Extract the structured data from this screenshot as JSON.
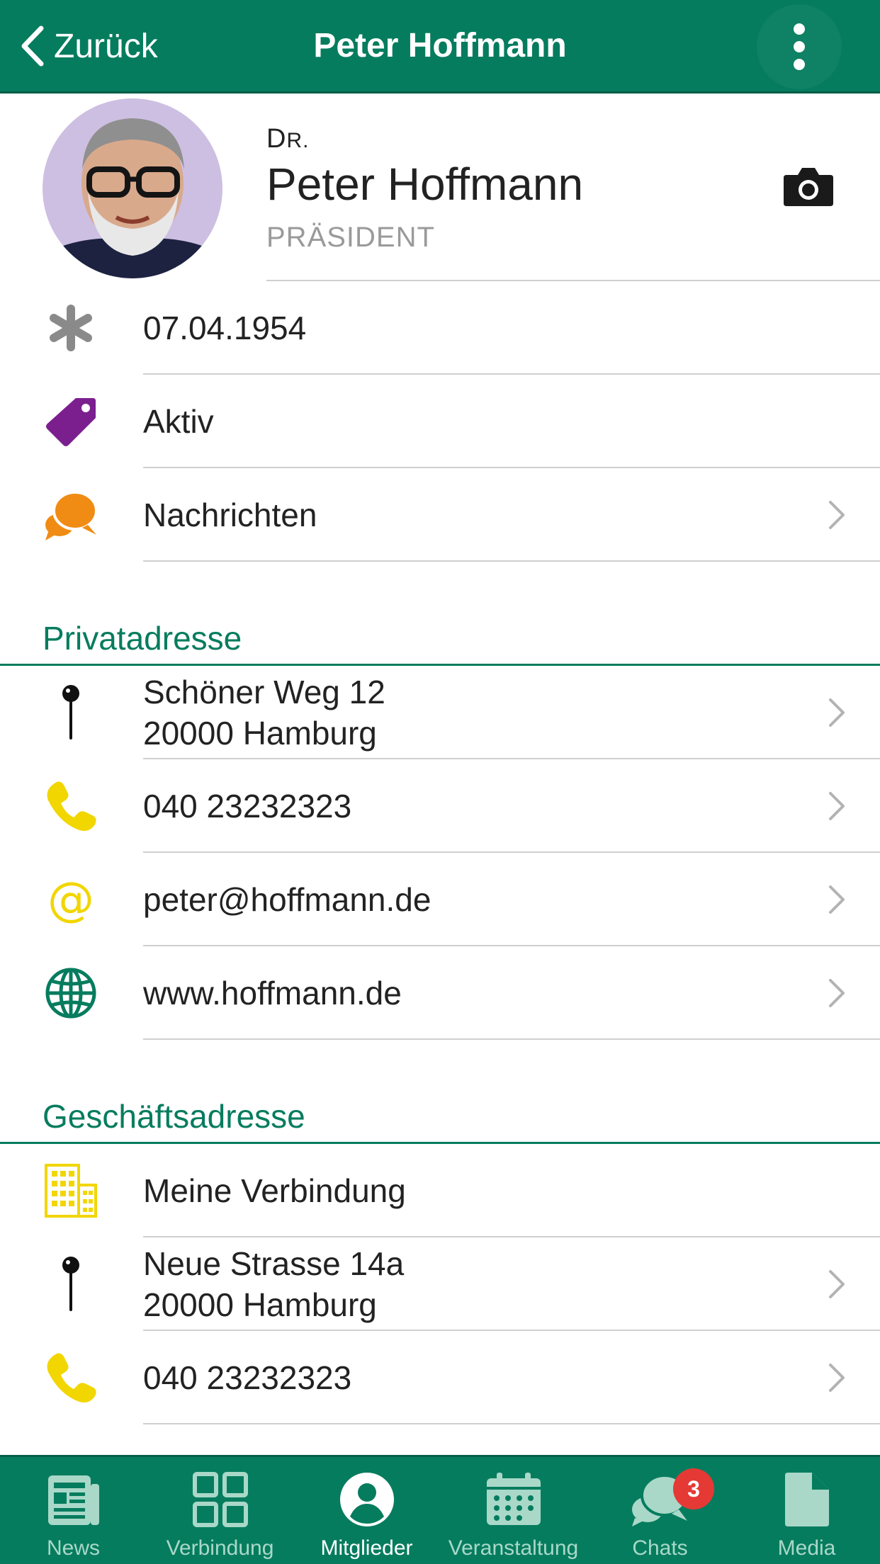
{
  "header": {
    "back_label": "Zurück",
    "title": "Peter Hoffmann",
    "menu_icon": "more-vertical-icon"
  },
  "profile": {
    "prefix_initial": "D",
    "prefix_rest": "R.",
    "name": "Peter Hoffmann",
    "role": "PRÄSIDENT",
    "camera_icon": "camera-icon"
  },
  "info": [
    {
      "icon": "asterisk-icon",
      "text": "07.04.1954"
    },
    {
      "icon": "tag-icon",
      "text": "Aktiv",
      "color": "#7b1f8f"
    },
    {
      "icon": "chat-bubbles-icon",
      "text": "Nachrichten",
      "color": "#f08c14"
    }
  ],
  "private_address": {
    "title": "Privatadresse",
    "street": "Schöner Weg 12",
    "city": "20000 Hamburg",
    "phone": "040 23232323",
    "email": "peter@hoffmann.de",
    "web": "www.hoffmann.de"
  },
  "business_address": {
    "title": "Geschäftsadresse",
    "company": "Meine Verbindung",
    "street": "Neue Strasse 14a",
    "city": "20000 Hamburg",
    "phone": "040 23232323"
  },
  "tabs": [
    {
      "label": "News",
      "icon": "newspaper-icon"
    },
    {
      "label": "Verbindung",
      "icon": "grid-icon"
    },
    {
      "label": "Mitglieder",
      "icon": "user-circle-icon",
      "active": true
    },
    {
      "label": "Veranstaltung",
      "icon": "calendar-icon"
    },
    {
      "label": "Chats",
      "icon": "chat-bubbles-icon",
      "badge": "3"
    },
    {
      "label": "Media",
      "icon": "document-icon"
    }
  ],
  "colors": {
    "primary": "#067c5e",
    "accent_yellow": "#f2d600",
    "badge_red": "#e53935"
  }
}
